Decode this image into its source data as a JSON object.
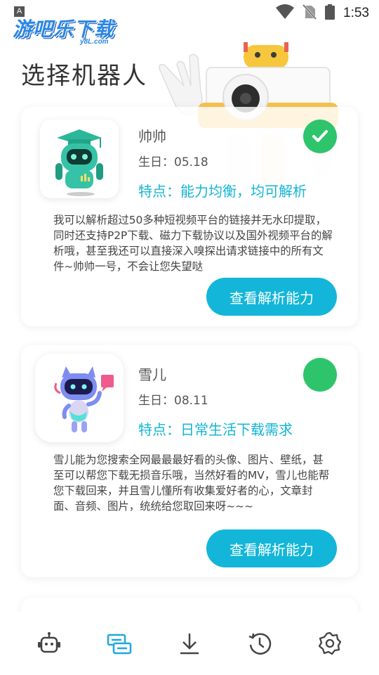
{
  "status_bar": {
    "indicator": "A",
    "time": "1:53",
    "icons": [
      "wifi-icon",
      "no-sim-icon",
      "battery-icon"
    ]
  },
  "watermark": {
    "main": "游吧乐下载",
    "sub": "y8L.com"
  },
  "page": {
    "title": "选择机器人"
  },
  "robots": [
    {
      "name": "帅帅",
      "birthday": "生日：05.18",
      "feature": "特点：能力均衡，均可解析",
      "description": "我可以解析超过50多种短视频平台的链接并无水印提取，同时还支持P2P下载、磁力下载协议以及国外视频平台的解析哦，甚至我还可以直接深入嗅探出请求链接中的所有文件~帅帅一号，不会让您失望哒",
      "button": "查看解析能力",
      "selected": true
    },
    {
      "name": "雪儿",
      "birthday": "生日：08.11",
      "feature": "特点：日常生活下载需求",
      "description": "雪儿能为您搜索全网最最最好看的头像、图片、壁纸，甚至可以帮您下载无损音乐哦，当然好看的MV，雪儿也能帮您下载回来，并且雪儿懂所有收集爱好者的心，文章封面、音频、图片，统统给您取回来呀~~~",
      "button": "查看解析能力",
      "selected": false
    }
  ],
  "colors": {
    "accent": "#13b6d8",
    "selected": "#2ec46b",
    "nav_active": "#1fa7e0",
    "nav_inactive": "#444444"
  },
  "bottom_nav": [
    "robot-icon",
    "parse-icon",
    "download-icon",
    "history-icon",
    "settings-icon"
  ],
  "bottom_nav_active": "parse-icon"
}
